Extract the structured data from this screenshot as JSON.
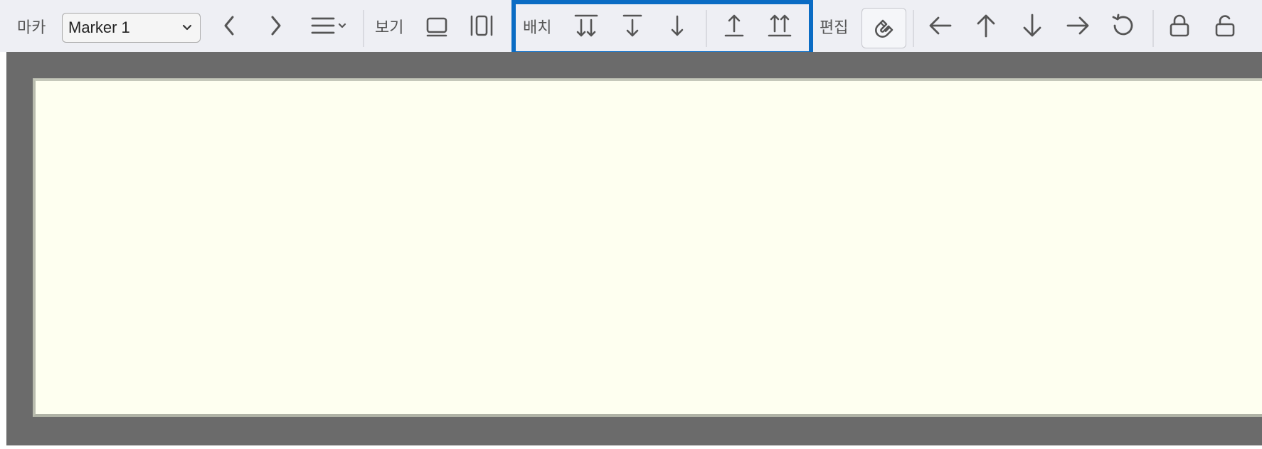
{
  "toolbar": {
    "marker_label": "마카",
    "marker_select_value": "Marker 1",
    "view_label": "보기",
    "arrange_label": "배치",
    "edit_label": "편집"
  },
  "colors": {
    "toolbar_bg": "#eeeff4",
    "icon": "#555555",
    "highlight_border": "#0a6cc4",
    "canvas_frame": "#6b6b6b",
    "page_bg": "#fefff0"
  },
  "icons": [
    "chevron-left-icon",
    "chevron-right-icon",
    "menu-icon",
    "view-single-icon",
    "view-double-icon",
    "move-to-bottom-icon",
    "move-down-icon",
    "move-down-small-icon",
    "move-up-icon",
    "move-to-top-icon",
    "magnet-icon",
    "arrow-left-icon",
    "arrow-up-icon",
    "arrow-down-icon",
    "arrow-right-icon",
    "rotate-icon",
    "lock-icon",
    "unlock-icon"
  ]
}
